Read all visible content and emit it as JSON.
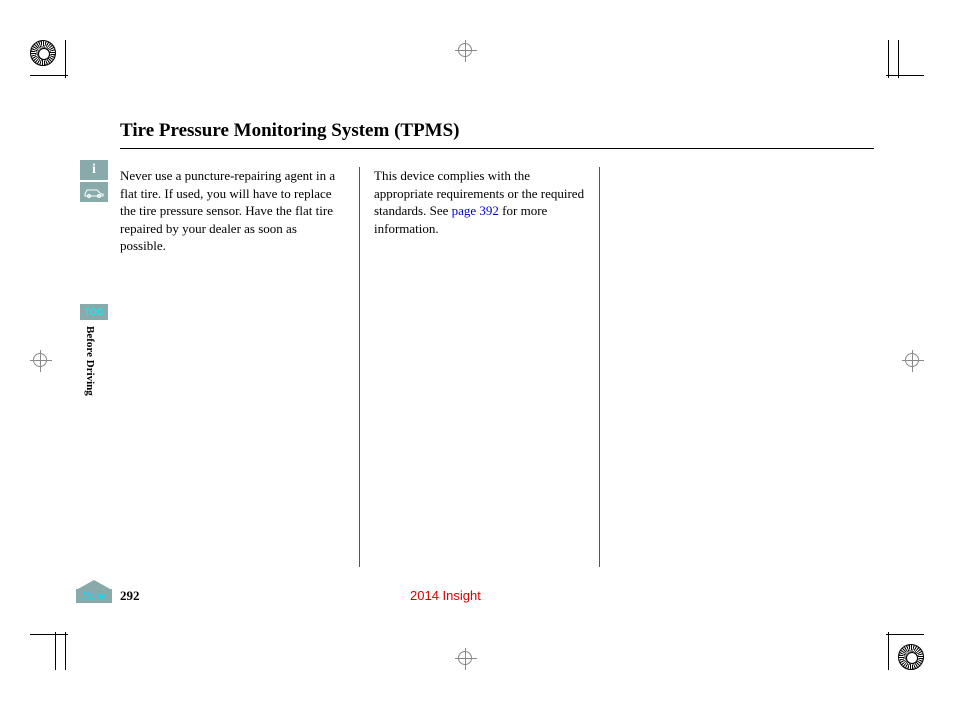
{
  "header": {
    "title": "Tire Pressure Monitoring System (TPMS)"
  },
  "columns": {
    "col1": "Never use a puncture-repairing agent in a flat tire. If used, you will have to replace the tire pressure sensor. Have the flat tire repaired by your dealer as soon as possible.",
    "col2_pre": "This device complies with the appropriate requirements or the required standards. See ",
    "col2_link": "page 392",
    "col2_post": " for more information."
  },
  "sidebar": {
    "info_glyph": "i",
    "car_glyph": "⚘",
    "toc_label": "TOC",
    "section_label": "Before Driving"
  },
  "footer": {
    "home_label": "Home",
    "page_number": "292",
    "model_year": "2014 Insight"
  }
}
